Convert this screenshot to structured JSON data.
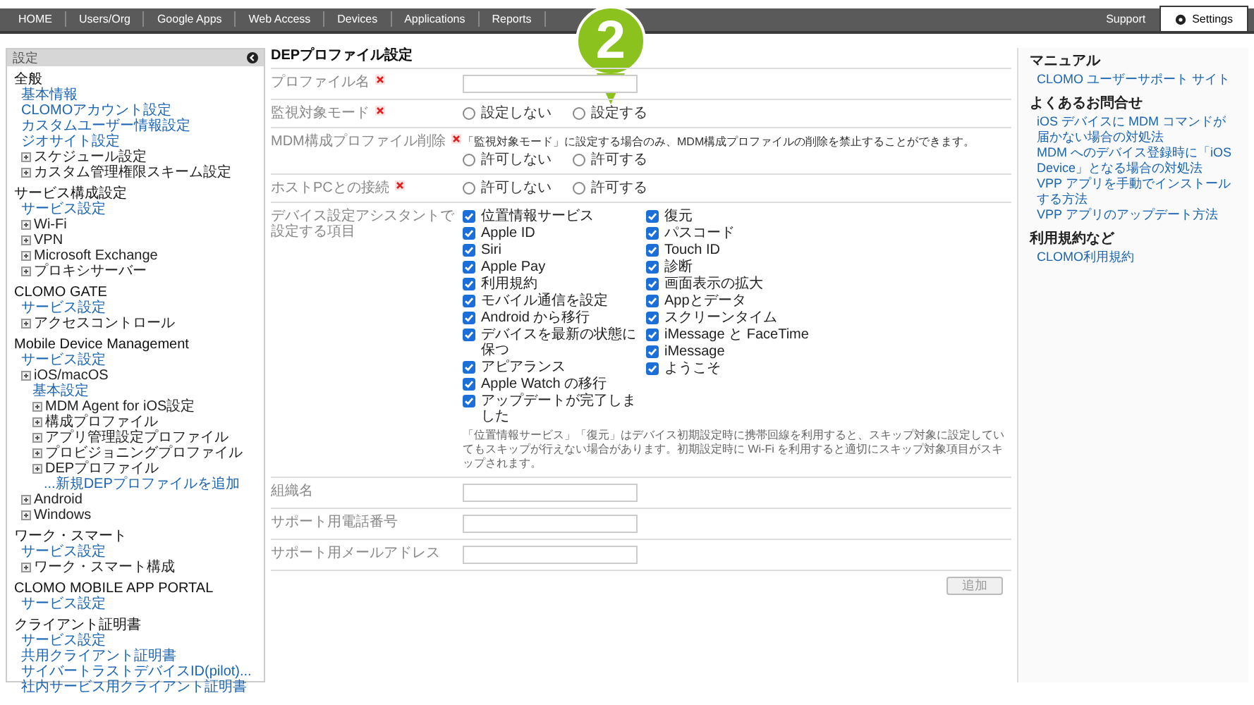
{
  "nav": {
    "tabs": [
      {
        "label": "HOME",
        "selected": false
      },
      {
        "label": "Users/Org",
        "selected": false
      },
      {
        "label": "Google Apps",
        "selected": false
      },
      {
        "label": "Web Access",
        "selected": false
      },
      {
        "label": "Devices",
        "selected": false
      },
      {
        "label": "Applications",
        "selected": false
      },
      {
        "label": "Reports",
        "selected": false
      }
    ],
    "right_tabs": [
      {
        "label": "Support",
        "selected": false,
        "kind": "plain"
      },
      {
        "label": "Settings",
        "selected": true,
        "kind": "gear"
      }
    ]
  },
  "callout": {
    "number": "2"
  },
  "sidebar": {
    "title": "設定",
    "groups": [
      {
        "title": "全般",
        "items": [
          {
            "label": "基本情報",
            "kind": "link"
          },
          {
            "label": "CLOMOアカウント設定",
            "kind": "link"
          },
          {
            "label": "カスタムユーザー情報設定",
            "kind": "link"
          },
          {
            "label": "ジオサイト設定",
            "kind": "link"
          },
          {
            "label": "スケジュール設定",
            "kind": "node"
          },
          {
            "label": "カスタム管理権限スキーム設定",
            "kind": "node"
          }
        ]
      },
      {
        "title": "サービス構成設定",
        "items": [
          {
            "label": "サービス設定",
            "kind": "link"
          },
          {
            "label": "Wi-Fi",
            "kind": "node"
          },
          {
            "label": "VPN",
            "kind": "node"
          },
          {
            "label": "Microsoft Exchange",
            "kind": "node"
          },
          {
            "label": "プロキシサーバー",
            "kind": "node"
          }
        ]
      },
      {
        "title": "CLOMO GATE",
        "items": [
          {
            "label": "サービス設定",
            "kind": "link"
          },
          {
            "label": "アクセスコントロール",
            "kind": "node"
          }
        ]
      },
      {
        "title": "Mobile Device Management",
        "items": [
          {
            "label": "サービス設定",
            "kind": "link"
          },
          {
            "label": "iOS/macOS",
            "kind": "node",
            "children": [
              {
                "label": "基本設定",
                "kind": "link"
              },
              {
                "label": "MDM Agent for iOS設定",
                "kind": "node"
              },
              {
                "label": "構成プロファイル",
                "kind": "node"
              },
              {
                "label": "アプリ管理設定プロファイル",
                "kind": "node"
              },
              {
                "label": "プロビジョニングプロファイル",
                "kind": "node"
              },
              {
                "label": "DEPプロファイル",
                "kind": "node",
                "children": [
                  {
                    "label": "...新規DEPプロファイルを追加",
                    "kind": "link"
                  }
                ]
              }
            ]
          },
          {
            "label": "Android",
            "kind": "node"
          },
          {
            "label": "Windows",
            "kind": "node"
          }
        ]
      },
      {
        "title": "ワーク・スマート",
        "items": [
          {
            "label": "サービス設定",
            "kind": "link"
          },
          {
            "label": "ワーク・スマート構成",
            "kind": "node"
          }
        ]
      },
      {
        "title": "CLOMO MOBILE APP PORTAL",
        "items": [
          {
            "label": "サービス設定",
            "kind": "link"
          }
        ]
      },
      {
        "title": "クライアント証明書",
        "items": [
          {
            "label": "サービス設定",
            "kind": "link"
          },
          {
            "label": "共用クライアント証明書",
            "kind": "link"
          },
          {
            "label": "サイバートラストデバイスID(pilot)...",
            "kind": "link"
          },
          {
            "label": "社内サービス用クライアント証明書",
            "kind": "link"
          }
        ]
      }
    ]
  },
  "form": {
    "title": "DEPプロファイル設定",
    "rows": [
      {
        "kind": "text",
        "label": "プロファイル名",
        "required": true
      },
      {
        "kind": "radio",
        "label": "監視対象モード",
        "required": true,
        "options": [
          {
            "label": "設定しない",
            "selected": false
          },
          {
            "label": "設定する",
            "selected": false
          }
        ]
      },
      {
        "kind": "radio",
        "label": "MDM構成プロファイル削除",
        "required": true,
        "note": "「監視対象モード」に設定する場合のみ、MDM構成プロファイルの削除を禁止することができます。",
        "options": [
          {
            "label": "許可しない",
            "selected": false
          },
          {
            "label": "許可する",
            "selected": false
          }
        ]
      },
      {
        "kind": "radio",
        "label": "ホストPCとの接続",
        "required": true,
        "options": [
          {
            "label": "許可しない",
            "selected": false
          },
          {
            "label": "許可する",
            "selected": false
          }
        ]
      },
      {
        "kind": "checks",
        "label": "デバイス設定アシスタントで設定する項目",
        "required": false,
        "columns": [
          [
            {
              "label": "位置情報サービス",
              "checked": true
            },
            {
              "label": "Apple ID",
              "checked": true
            },
            {
              "label": "Siri",
              "checked": true
            },
            {
              "label": "Apple Pay",
              "checked": true
            },
            {
              "label": "利用規約",
              "checked": true
            },
            {
              "label": "モバイル通信を設定",
              "checked": true
            },
            {
              "label": "Android から移行",
              "checked": true
            },
            {
              "label": "デバイスを最新の状態に保つ",
              "checked": true
            },
            {
              "label": "アピアランス",
              "checked": true
            },
            {
              "label": "Apple Watch の移行",
              "checked": true
            },
            {
              "label": "アップデートが完了しました",
              "checked": true
            }
          ],
          [
            {
              "label": "復元",
              "checked": true
            },
            {
              "label": "パスコード",
              "checked": true
            },
            {
              "label": "Touch ID",
              "checked": true
            },
            {
              "label": "診断",
              "checked": true
            },
            {
              "label": "画面表示の拡大",
              "checked": true
            },
            {
              "label": "Appとデータ",
              "checked": true
            },
            {
              "label": "スクリーンタイム",
              "checked": true
            },
            {
              "label": "iMessage と FaceTime",
              "checked": true
            },
            {
              "label": "iMessage",
              "checked": true
            },
            {
              "label": "ようこそ",
              "checked": true
            }
          ]
        ],
        "note": "「位置情報サービス」「復元」はデバイス初期設定時に携帯回線を利用すると、スキップ対象に設定していてもスキップが行えない場合があります。初期設定時に Wi-Fi を利用すると適切にスキップ対象項目がスキップされます。"
      },
      {
        "kind": "text",
        "label": "組織名",
        "required": false
      },
      {
        "kind": "text",
        "label": "サポート用電話番号",
        "required": false
      },
      {
        "kind": "text",
        "label": "サポート用メールアドレス",
        "required": false
      }
    ],
    "submit": "追加"
  },
  "help": {
    "sections": [
      {
        "title": "マニュアル",
        "links": [
          "CLOMO ユーザーサポート サイト"
        ]
      },
      {
        "title": "よくあるお問合せ",
        "links": [
          "iOS デバイスに MDM コマンドが届かない場合の対処法",
          "MDM へのデバイス登録時に「iOS Device」となる場合の対処法",
          "VPP アプリを手動でインストールする方法",
          "VPP アプリのアップデート方法"
        ]
      },
      {
        "title": "利用規約など",
        "links": [
          "CLOMO利用規約"
        ]
      }
    ]
  }
}
